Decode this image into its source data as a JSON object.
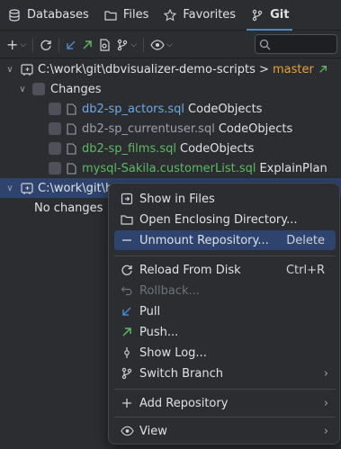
{
  "tabs": [
    {
      "label": "Databases",
      "icon": "database-icon"
    },
    {
      "label": "Files",
      "icon": "folder-icon"
    },
    {
      "label": "Favorites",
      "icon": "star-icon"
    },
    {
      "label": "Git",
      "icon": "git-branch-icon",
      "active": true
    }
  ],
  "search": {
    "placeholder": ""
  },
  "tree": {
    "repo1": {
      "path": "C:\\work\\git\\dbvisualizer-demo-scripts > ",
      "branch": "master"
    },
    "changes_label": "Changes",
    "files": [
      {
        "name": "db2-sp_actors.sql",
        "folder": "CodeObjects",
        "color": "#6fa8e6"
      },
      {
        "name": "db2-sp_currentuser.sql",
        "folder": "CodeObjects",
        "color": "#9da0a8"
      },
      {
        "name": "db2-sp_films.sql",
        "folder": "CodeObjects",
        "color": "#5fb865"
      },
      {
        "name": "mysql-Sakila.customerList.sql",
        "folder": "ExplainPlan",
        "color": "#5fb865"
      }
    ],
    "repo2": {
      "path": "C:\\work\\git\\h"
    },
    "no_changes": "No changes"
  },
  "menu": {
    "show_in_files": "Show in Files",
    "open_enclosing": "Open Enclosing Directory...",
    "unmount": "Unmount Repository...",
    "unmount_shortcut": "Delete",
    "reload": "Reload From Disk",
    "reload_shortcut": "Ctrl+R",
    "rollback": "Rollback...",
    "pull": "Pull",
    "push": "Push...",
    "show_log": "Show Log...",
    "switch_branch": "Switch Branch",
    "add_repository": "Add Repository",
    "view": "View"
  }
}
